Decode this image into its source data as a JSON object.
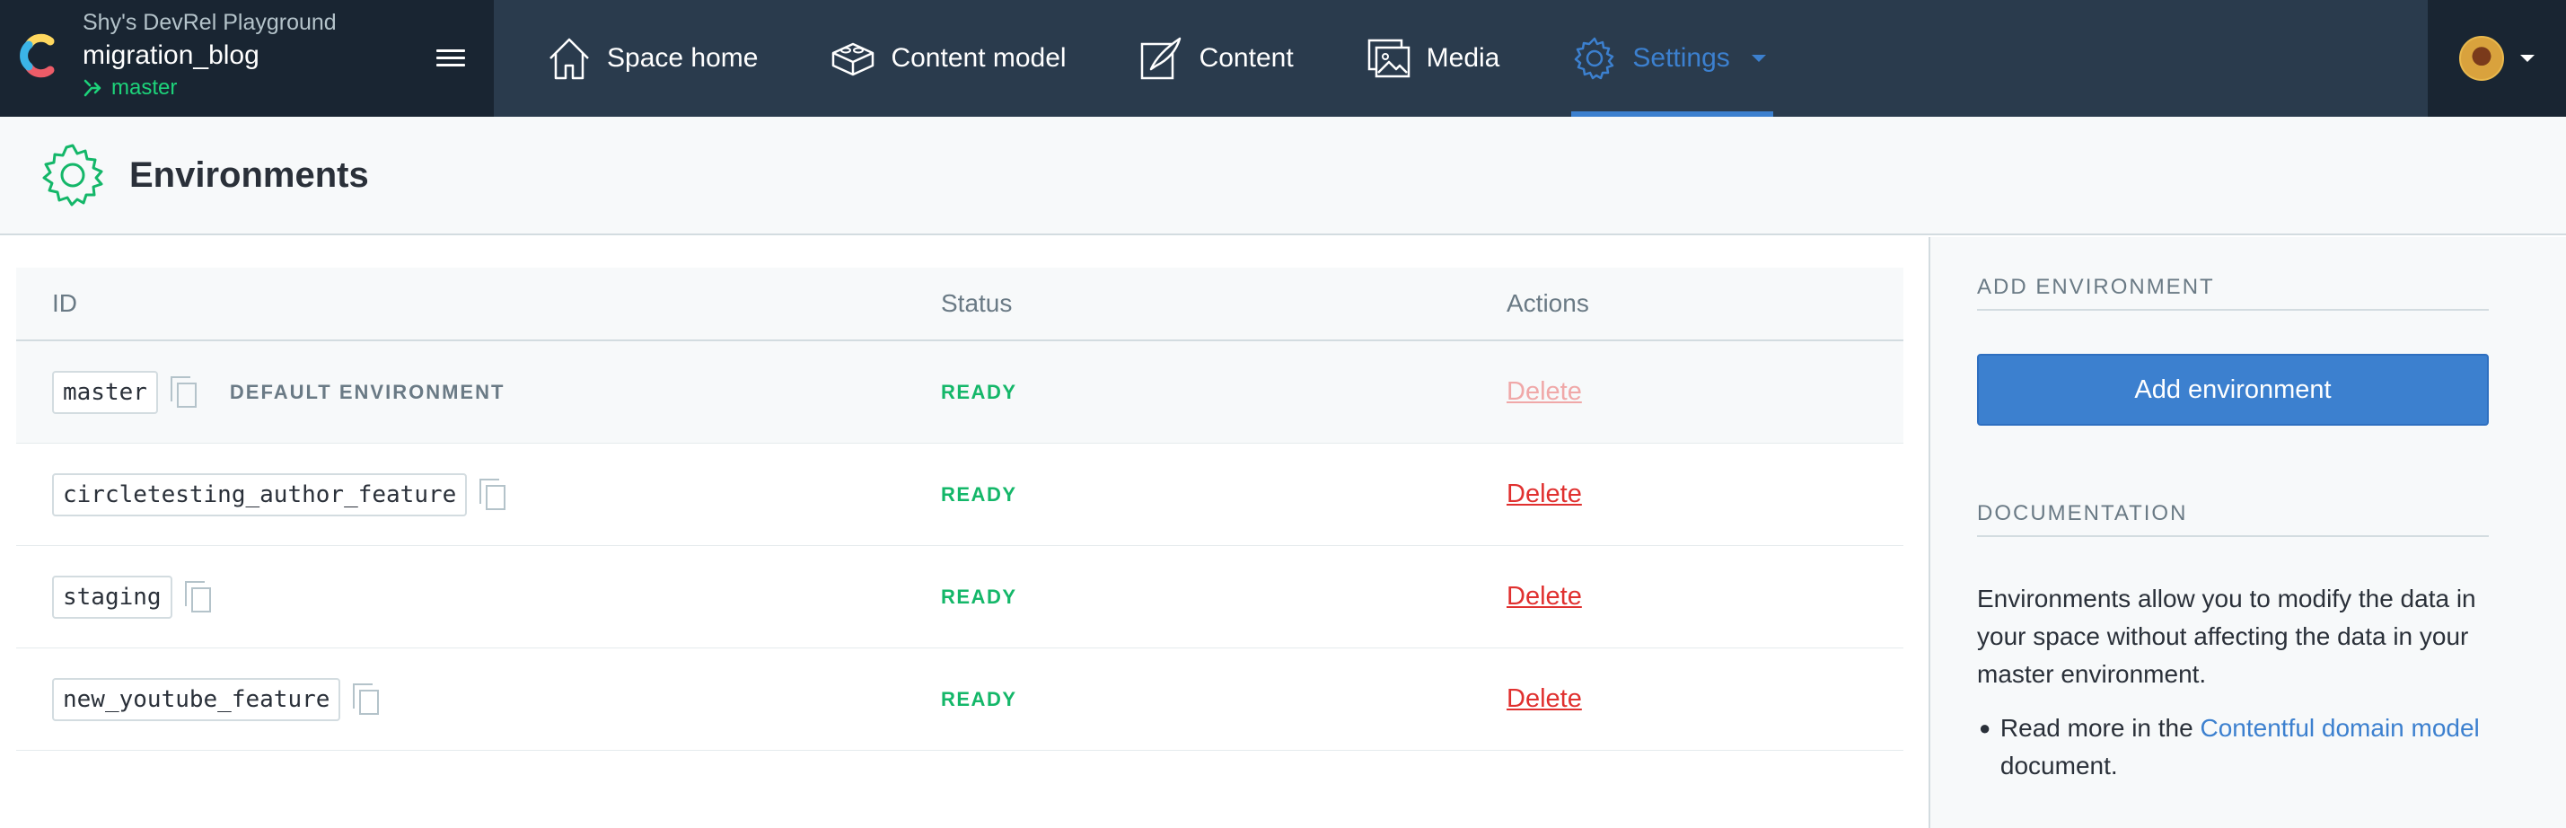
{
  "space": {
    "org_name": "Shy's DevRel Playground",
    "space_name": "migration_blog",
    "environment": "master"
  },
  "nav": {
    "items": [
      {
        "label": "Space home",
        "icon": "house-icon"
      },
      {
        "label": "Content model",
        "icon": "blocks-icon"
      },
      {
        "label": "Content",
        "icon": "pen-icon"
      },
      {
        "label": "Media",
        "icon": "image-icon"
      },
      {
        "label": "Settings",
        "icon": "gear-icon",
        "active": true
      }
    ]
  },
  "page": {
    "title": "Environments",
    "icon": "gear-icon"
  },
  "table": {
    "headers": {
      "id": "ID",
      "status": "Status",
      "actions": "Actions"
    },
    "rows": [
      {
        "id": "master",
        "badge": "DEFAULT ENVIRONMENT",
        "status": "READY",
        "action": "Delete",
        "action_disabled": true
      },
      {
        "id": "circletesting_author_feature",
        "status": "READY",
        "action": "Delete"
      },
      {
        "id": "staging",
        "status": "READY",
        "action": "Delete"
      },
      {
        "id": "new_youtube_feature",
        "status": "READY",
        "action": "Delete"
      }
    ]
  },
  "sidebar": {
    "add_heading": "ADD ENVIRONMENT",
    "add_button": "Add environment",
    "doc_heading": "DOCUMENTATION",
    "doc_text": "Environments allow you to modify the data in your space without affecting the data in your master environment.",
    "doc_bullet_prefix": "Read more in the ",
    "doc_link": "Contentful domain model",
    "doc_bullet_suffix": " document."
  },
  "colors": {
    "nav_bg": "#2a3b4d",
    "nav_dark": "#192532",
    "accent": "#3c80cf",
    "ready_green": "#14b769",
    "delete_red": "#e0302f"
  }
}
